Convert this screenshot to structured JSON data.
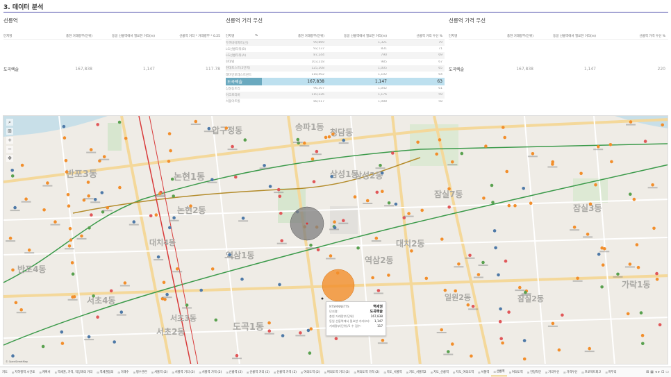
{
  "page": {
    "title": "3. 데이터 분석"
  },
  "left_panel": {
    "title": "선릉역",
    "columns": [
      "단지명",
      "총연 거래량부(단위)",
      "동일 선릉역에서 필요한 거리(m)",
      "선릉역 거리 * 거래량부 * 0.25"
    ],
    "row": {
      "name": "도곡렉슬",
      "volume": "167,838",
      "distance": "1,147",
      "score": "117.78"
    }
  },
  "mid_panel": {
    "title": "선릉역 거리 우선",
    "columns": [
      "단지명",
      "%",
      "총연 거래량부(단위)",
      "동일 선릉역에서 필요한 거리(m)",
      "선릉역 거리 우선 %"
    ],
    "rows": [
      {
        "name": "두꺼비아파트(선)",
        "volume": "99,869",
        "distance": "1,321",
        "score": "79"
      },
      {
        "name": "LG선릉타워(B)",
        "volume": "92,137",
        "distance": "831",
        "score": "71"
      },
      {
        "name": "LG선릉타워(A)",
        "volume": "87,244",
        "distance": "790",
        "score": "69"
      },
      {
        "name": "현대빌",
        "volume": "103,218",
        "distance": "985",
        "score": "67"
      },
      {
        "name": "현대토스트(2단지)",
        "volume": "125,208",
        "distance": "1,005",
        "score": "65"
      },
      {
        "name": "래미안포레스트윈드",
        "volume": "118,402",
        "distance": "1,102",
        "score": "64"
      },
      {
        "name": "도곡렉슬",
        "volume": "167,838",
        "distance": "1,147",
        "score": "63",
        "selected": true
      },
      {
        "name": "삼성동트리",
        "volume": "96,307",
        "distance": "1,042",
        "score": "61"
      },
      {
        "name": "아크로리버",
        "volume": "110,226",
        "distance": "1,176",
        "score": "59"
      },
      {
        "name": "서울아트빌",
        "volume": "88,517",
        "distance": "1,088",
        "score": "58"
      }
    ]
  },
  "right_panel": {
    "title": "선릉역 가격 우선",
    "columns": [
      "단지명",
      "총연 거래량부(단위)",
      "동일 선릉역에서 필요한 거리(m)",
      "선릉역 가격 우선 %"
    ],
    "row": {
      "name": "도곡렉슬",
      "volume": "167,838",
      "distance": "1,147",
      "score": "220"
    }
  },
  "map": {
    "attribution": "© OpenStreetMap",
    "tools": [
      "⌕",
      "⊞",
      "+",
      "−",
      "✥"
    ],
    "areas": [
      {
        "label": "반포3동",
        "size": 13
      },
      {
        "label": "논현1동",
        "size": 13
      },
      {
        "label": "논현2동",
        "size": 12
      },
      {
        "label": "압구정동",
        "size": 12
      },
      {
        "label": "청담동",
        "size": 12
      },
      {
        "label": "삼성1동",
        "size": 12
      },
      {
        "label": "삼성2동",
        "size": 12
      },
      {
        "label": "역삼1동",
        "size": 12
      },
      {
        "label": "역삼2동",
        "size": 12
      },
      {
        "label": "대치2동",
        "size": 12
      },
      {
        "label": "대치4동",
        "size": 11
      },
      {
        "label": "반포4동",
        "size": 12
      },
      {
        "label": "서초4동",
        "size": 12
      },
      {
        "label": "서초2동",
        "size": 12
      },
      {
        "label": "서초3동",
        "size": 11
      },
      {
        "label": "도곡1동",
        "size": 13
      },
      {
        "label": "잠실7동",
        "size": 12
      },
      {
        "label": "잠실3동",
        "size": 12
      },
      {
        "label": "일원2동",
        "size": 11
      },
      {
        "label": "잠실2동",
        "size": 11
      },
      {
        "label": "가락1동",
        "size": 12
      },
      {
        "label": "송파1동",
        "size": 12
      }
    ],
    "colors": {
      "orange": "#f28e2b",
      "blue": "#4e79a7",
      "red": "#e15759",
      "teal": "#59a14f",
      "gray_circle": "#7f7f7f",
      "orange_circle": "#f28e2b"
    }
  },
  "tooltip": {
    "rows": [
      {
        "label": "NTSMNNETTS",
        "value": "역세권",
        "bold": true
      },
      {
        "label": "단지명:",
        "value": "도곡렉슬",
        "bold": true
      },
      {
        "label": "총연 거래량부(단위)",
        "value": "167,838"
      },
      {
        "label": "동일 선릉역에서 필요한 거리(m):",
        "value": "1,147"
      },
      {
        "label": "거래량부(단위)/1 수 점수:",
        "value": "117"
      }
    ]
  },
  "tabs": [
    {
      "label": "지도"
    },
    {
      "label": "지하철역 시간표"
    },
    {
      "label": "계획서"
    },
    {
      "label": "역세권, 가격, 직장과의 거리"
    },
    {
      "label": "역세권점의"
    },
    {
      "label": "거래수"
    },
    {
      "label": "평수관련"
    },
    {
      "label": "서울역 (2)"
    },
    {
      "label": "서울역 거리 (2)"
    },
    {
      "label": "서울역 가격 (2)"
    },
    {
      "label": "선릉역 (2)"
    },
    {
      "label": "선릉역 거리 (2)"
    },
    {
      "label": "선릉역 가격 (2)"
    },
    {
      "label": "여의도역 (2)"
    },
    {
      "label": "여의도역 거리 (2)"
    },
    {
      "label": "여의도역 가격 (2)"
    },
    {
      "label": "지도_서울역"
    },
    {
      "label": "지도_서울역2"
    },
    {
      "label": "지도_선릉역"
    },
    {
      "label": "지도_여의도역"
    },
    {
      "label": "서울역"
    },
    {
      "label": "선릉역",
      "active": true
    },
    {
      "label": "여의도역"
    },
    {
      "label": "전형적인"
    },
    {
      "label": "거리우선"
    },
    {
      "label": "가격우선"
    },
    {
      "label": "프로젝트회고"
    },
    {
      "label": "마무리"
    }
  ],
  "tab_nav": [
    "⊞",
    "▦",
    "◂",
    "▸",
    "⊡",
    "▭"
  ]
}
